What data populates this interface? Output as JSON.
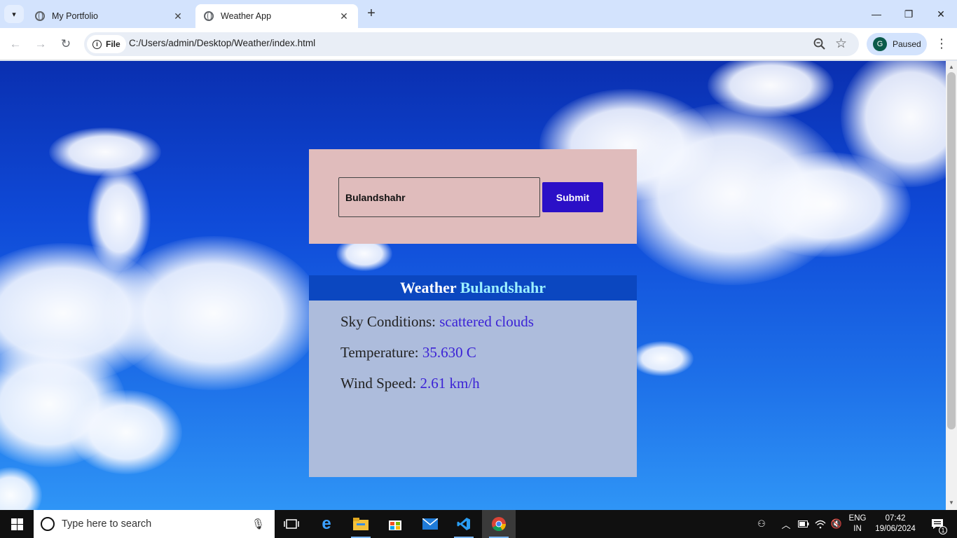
{
  "browser": {
    "tabs": [
      {
        "title": "My Portfolio",
        "active": false
      },
      {
        "title": "Weather App",
        "active": true
      }
    ],
    "new_tab": "+",
    "address": {
      "chip": "File",
      "url": "C:/Users/admin/Desktop/Weather/index.html"
    },
    "profile": {
      "initial": "G",
      "status": "Paused"
    }
  },
  "form": {
    "city_value": "Bulandshahr",
    "submit_label": "Submit"
  },
  "weather": {
    "header_prefix": "Weather",
    "city": "Bulandshahr",
    "sky_label": "Sky Conditions:",
    "sky_value": "scattered clouds",
    "temp_label": "Temperature:",
    "temp_value": "35.630 C",
    "wind_label": "Wind Speed:",
    "wind_value": "2.61 km/h"
  },
  "taskbar": {
    "search_placeholder": "Type here to search",
    "lang_line1": "ENG",
    "lang_line2": "IN",
    "time": "07:42",
    "date": "19/06/2024",
    "notification_count": "1"
  },
  "colors": {
    "form_card_bg": "#e0bcbc",
    "submit_bg": "#2b10c7",
    "weather_header_bg": "#0b47c0",
    "weather_card_bg": "#adbcdc",
    "value_color": "#3b22d6"
  }
}
